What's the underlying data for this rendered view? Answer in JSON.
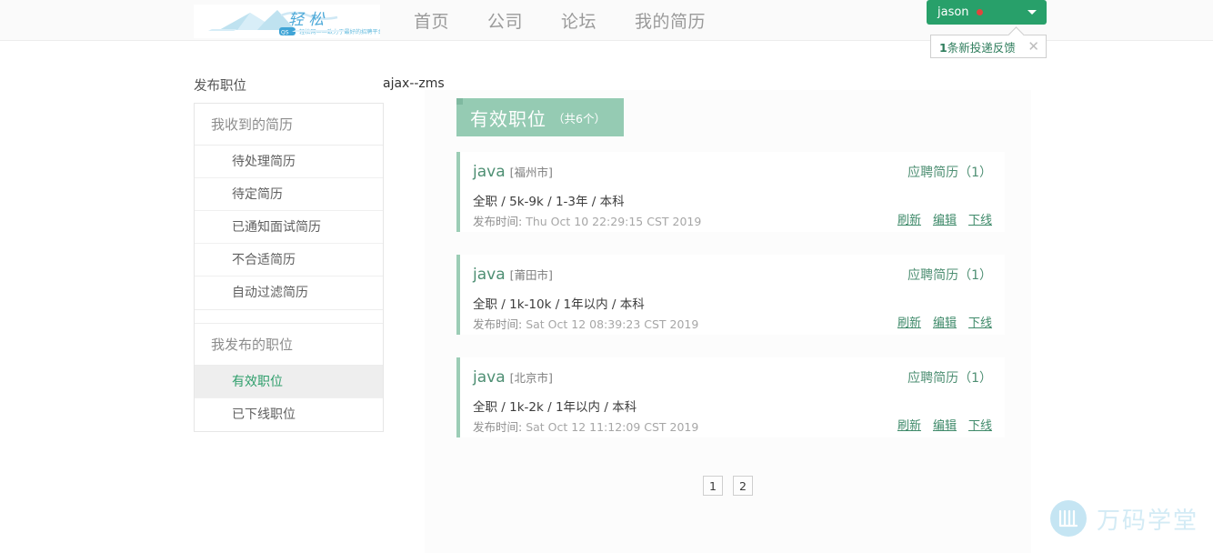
{
  "header": {
    "logo_alt": "qingsong-logo",
    "nav": [
      {
        "label": "首页",
        "name": "nav-home"
      },
      {
        "label": "公司",
        "name": "nav-company"
      },
      {
        "label": "论坛",
        "name": "nav-forum"
      },
      {
        "label": "我的简历",
        "name": "nav-my-resume"
      }
    ],
    "user": {
      "name": "jason",
      "has_notification": true,
      "notification_color": "#e2453c",
      "button_color": "#28a06a",
      "caret": "chevron-down-icon"
    },
    "feedback_tip": {
      "count": "1",
      "text": "条新投递反馈",
      "close": "✕"
    }
  },
  "subheader": {
    "publish_job": "发布职位",
    "ajax_label": "ajax--zms"
  },
  "sidebar": {
    "groups": [
      {
        "title": "我收到的简历",
        "items": [
          {
            "label": "待处理简历",
            "active": false
          },
          {
            "label": "待定简历",
            "active": false
          },
          {
            "label": "已通知面试简历",
            "active": false
          },
          {
            "label": "不合适简历",
            "active": false
          },
          {
            "label": "自动过滤简历",
            "active": false
          }
        ]
      },
      {
        "title": "我发布的职位",
        "items": [
          {
            "label": "有效职位",
            "active": true
          },
          {
            "label": "已下线职位",
            "active": false
          }
        ]
      }
    ]
  },
  "main": {
    "banner": {
      "title": "有效职位",
      "count": "（共6个）",
      "color": "#95cbb3"
    },
    "time_label": "发布时间:",
    "jobs": [
      {
        "title": "java",
        "city": "[福州市]",
        "meta": "全职 / 5k-9k / 1-3年 / 本科",
        "time": "Thu Oct 10 22:29:15 CST 2019",
        "apply": "应聘简历（1）",
        "actions": [
          "刷新",
          "编辑",
          "下线"
        ]
      },
      {
        "title": "java",
        "city": "[莆田市]",
        "meta": "全职 / 1k-10k / 1年以内 / 本科",
        "time": "Sat Oct 12 08:39:23 CST 2019",
        "apply": "应聘简历（1）",
        "actions": [
          "刷新",
          "编辑",
          "下线"
        ]
      },
      {
        "title": "java",
        "city": "[北京市]",
        "meta": "全职 / 1k-2k / 1年以内 / 本科",
        "time": "Sat Oct 12 11:12:09 CST 2019",
        "apply": "应聘简历（1）",
        "actions": [
          "刷新",
          "编辑",
          "下线"
        ]
      }
    ],
    "pagination": {
      "pages": [
        "1",
        "2"
      ]
    }
  },
  "watermark": {
    "text": "万码学堂",
    "logo": "wm-logo-icon"
  }
}
